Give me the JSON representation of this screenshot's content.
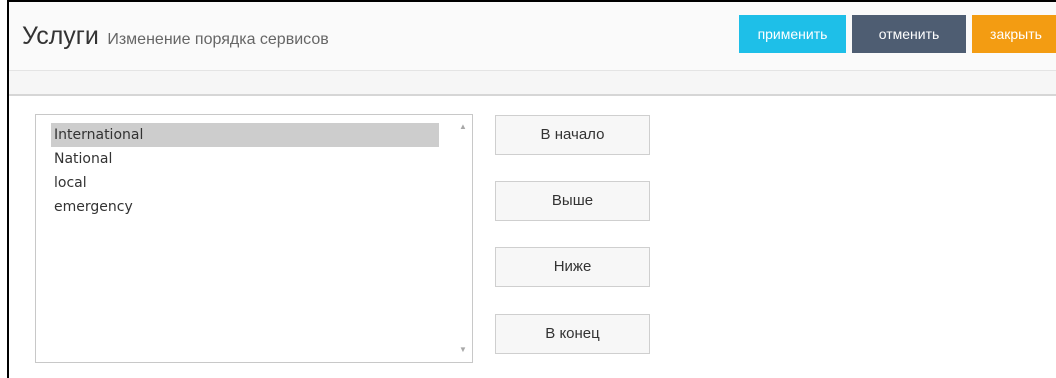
{
  "header": {
    "title": "Услуги",
    "subtitle": "Изменение порядка сервисов",
    "buttons": {
      "apply": "применить",
      "cancel": "отменить",
      "close": "закрыть"
    },
    "colors": {
      "apply": "#1ebfe8",
      "cancel": "#4e5d72",
      "close": "#f39c12"
    }
  },
  "services": {
    "items": [
      "International",
      "National",
      "local",
      "emergency"
    ],
    "selected": "International",
    "scroll_up_icon": "triangle-up-icon",
    "scroll_down_icon": "triangle-down-icon"
  },
  "order_buttons": {
    "to_top": "В начало",
    "up": "Выше",
    "down": "Ниже",
    "to_bottom": "В конец"
  }
}
